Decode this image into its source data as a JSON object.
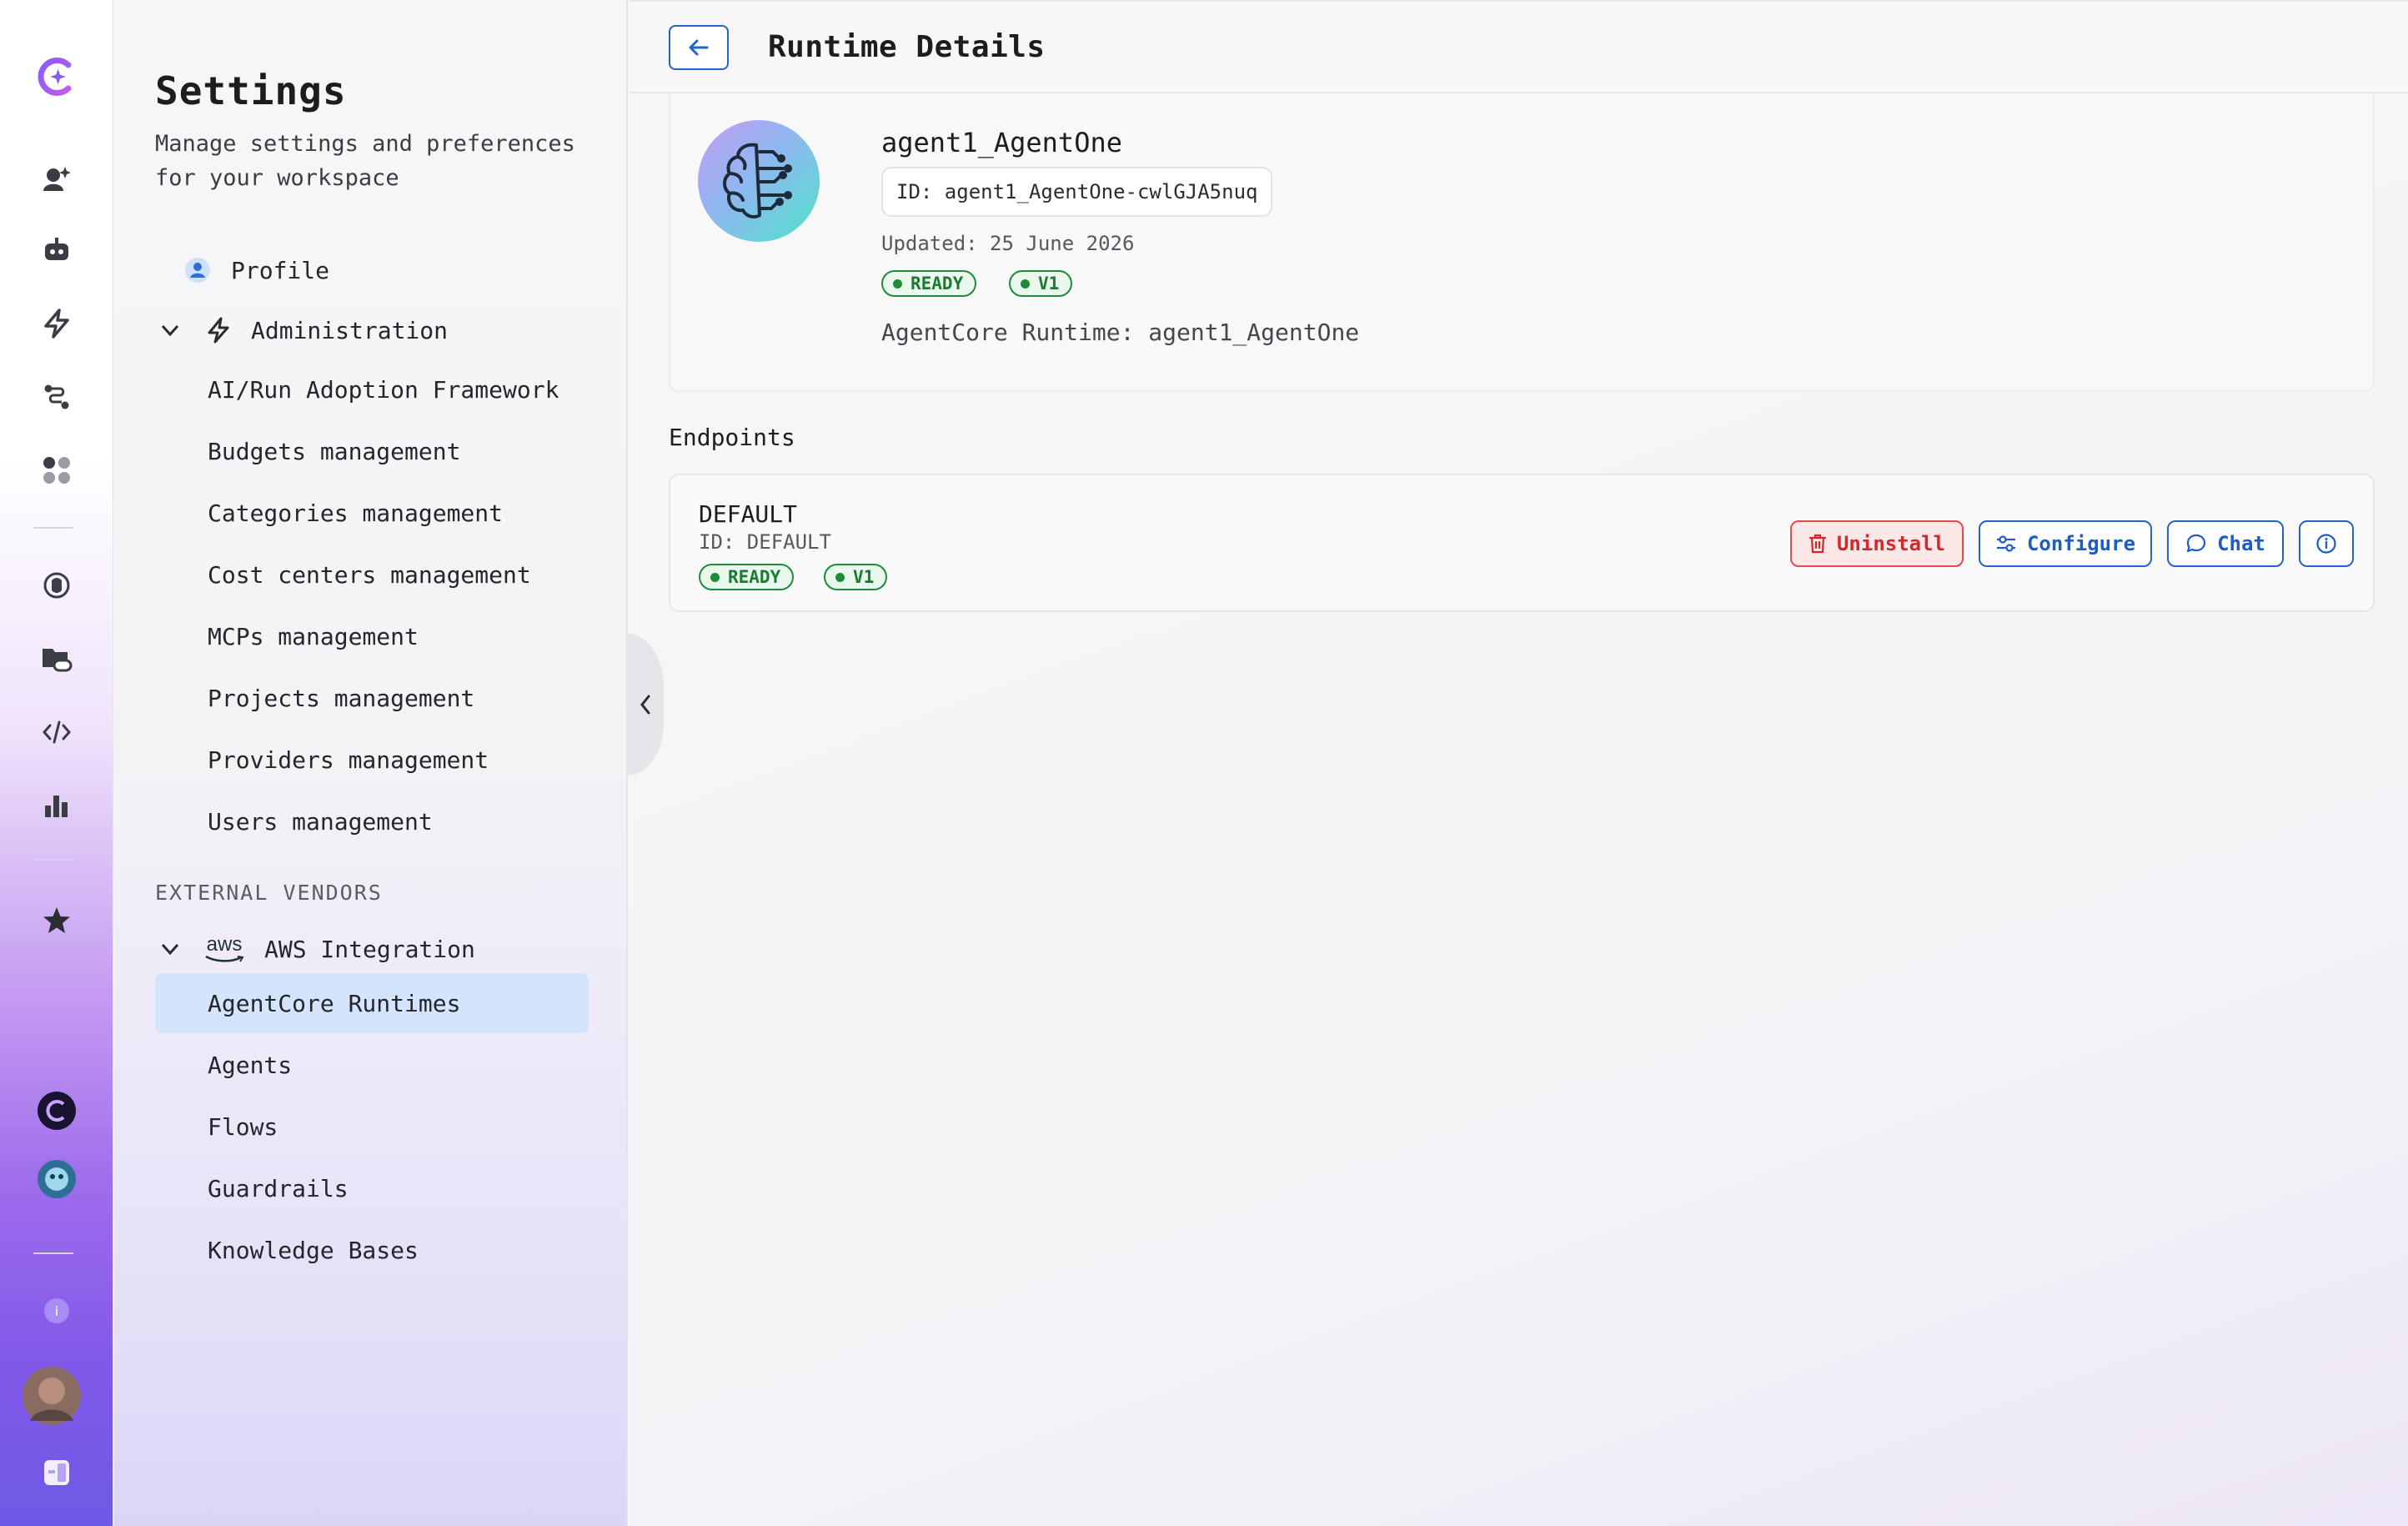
{
  "rail": {
    "icons": [
      "app-logo-icon",
      "assistants-icon",
      "bot-icon",
      "lightning-icon",
      "workflow-icon",
      "apps-icon",
      "brain-icon",
      "folder-link-icon",
      "code-icon",
      "analytics-icon",
      "star-icon",
      "assistant-avatar-icon",
      "assistant-avatar-2-icon",
      "info-icon",
      "user-avatar",
      "docs-icon"
    ]
  },
  "settings": {
    "title": "Settings",
    "subtitle": "Manage settings and preferences for your workspace",
    "profile": "Profile",
    "administration": "Administration",
    "admin_items": [
      "AI/Run Adoption Framework",
      "Budgets management",
      "Categories management",
      "Cost centers management",
      "MCPs management",
      "Projects management",
      "Providers management",
      "Users management"
    ],
    "external_vendors_label": "EXTERNAL VENDORS",
    "aws_logo_text": "aws",
    "aws_integration": "AWS Integration",
    "aws_items": [
      "AgentCore Runtimes",
      "Agents",
      "Flows",
      "Guardrails",
      "Knowledge Bases"
    ],
    "active_item": "AgentCore Runtimes"
  },
  "header": {
    "title": "Runtime Details"
  },
  "runtime": {
    "name": "agent1_AgentOne",
    "id_label": "ID: agent1_AgentOne-cwlGJA5nuq",
    "updated": "Updated: 25 June 2026",
    "status": "READY",
    "version": "V1",
    "description": "AgentCore Runtime: agent1_AgentOne"
  },
  "endpoints": {
    "heading": "Endpoints",
    "items": [
      {
        "name": "DEFAULT",
        "id_label": "ID: DEFAULT",
        "status": "READY",
        "version": "V1",
        "actions": {
          "uninstall": "Uninstall",
          "configure": "Configure",
          "chat": "Chat"
        }
      }
    ]
  },
  "colors": {
    "accent": "#2563c9",
    "active_bg": "#d3e4fc",
    "ready": "#1f8a3b",
    "danger": "#d3262d"
  }
}
